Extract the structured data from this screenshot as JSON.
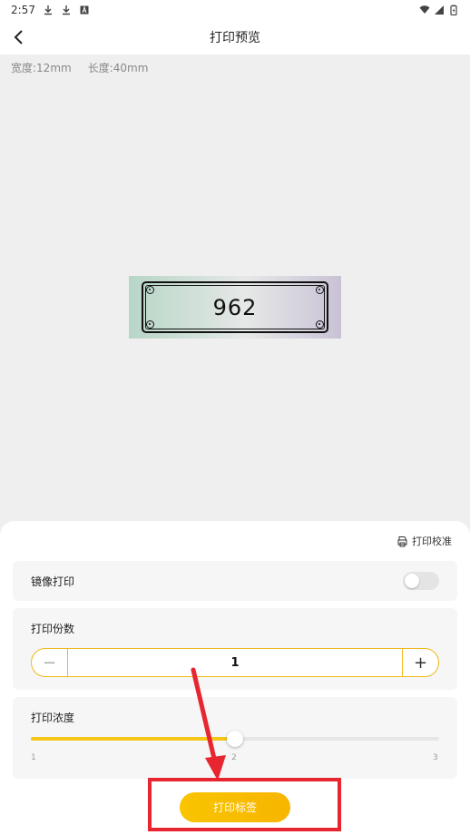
{
  "status_bar": {
    "time": "2:57",
    "icons": [
      "download-icon",
      "download-icon",
      "a-notification-icon"
    ],
    "right_icons": [
      "wifi-icon",
      "signal-icon",
      "battery-icon"
    ]
  },
  "header": {
    "title": "打印预览",
    "back_icon": "chevron-left-icon"
  },
  "label_info": {
    "width": "宽度:12mm",
    "length": "长度:40mm"
  },
  "preview": {
    "text": "962",
    "colors": {
      "left": "#b7d6c7",
      "mid": "#e6e8e7",
      "right": "#c9c2d6"
    }
  },
  "settings": {
    "calibration_label": "打印校准",
    "mirror_label": "镜像打印",
    "mirror_on": false,
    "copies_label": "打印份数",
    "copies_value": "1",
    "minus_symbol": "−",
    "plus_symbol": "+",
    "density_label": "打印浓度",
    "density_value": 2,
    "density_min": 1,
    "density_max": 3,
    "density_ticks": [
      "1",
      "2",
      "3"
    ]
  },
  "print_button": {
    "label": "打印标签"
  },
  "colors": {
    "accent": "#f5c518",
    "annotation": "#e8262f"
  }
}
